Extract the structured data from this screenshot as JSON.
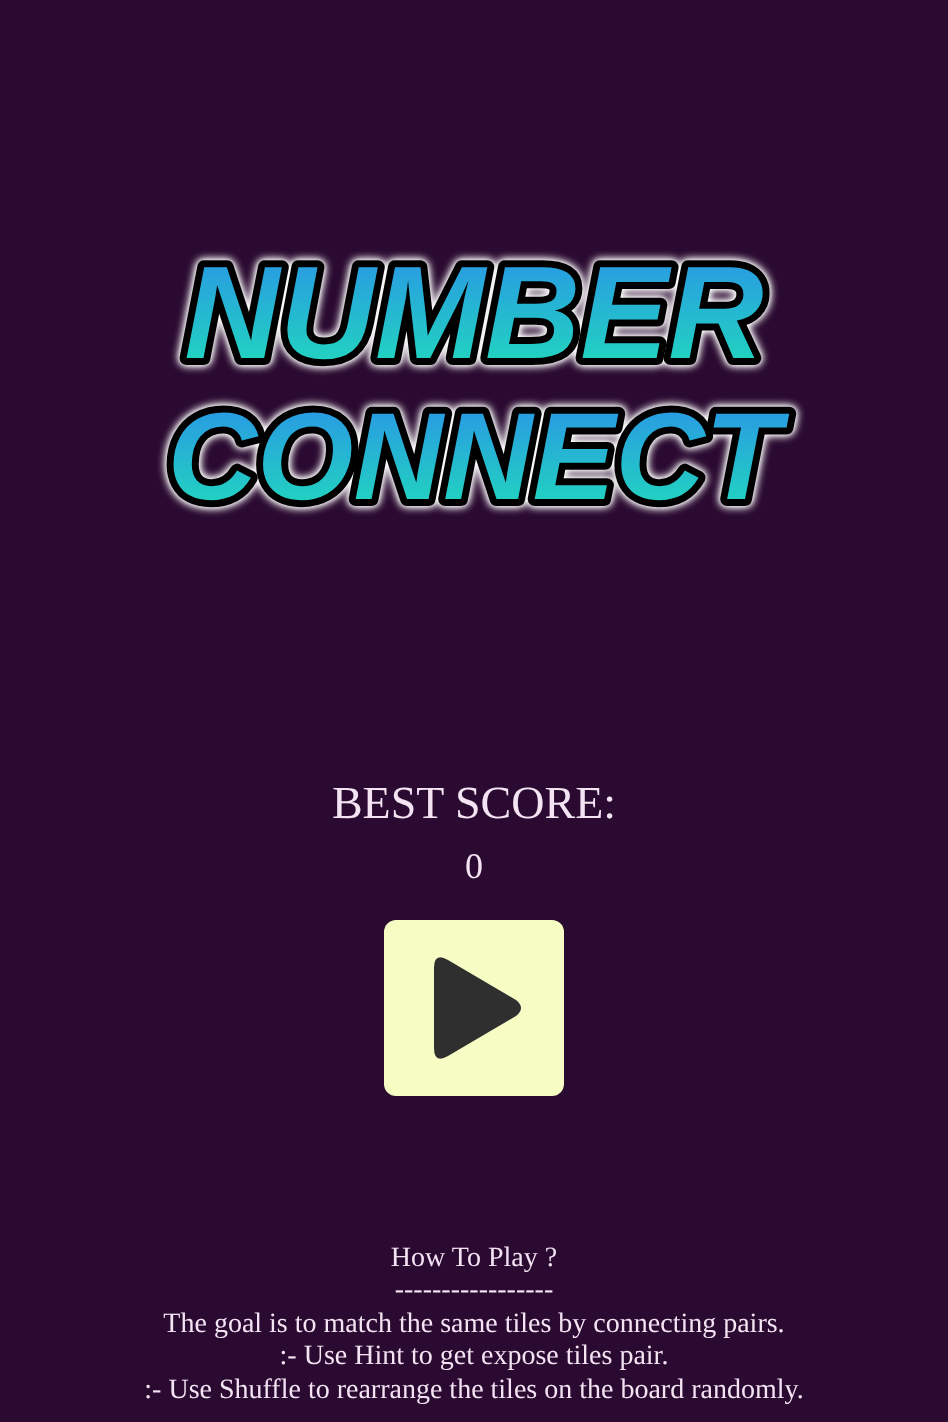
{
  "title": {
    "lines": [
      "NUMBER",
      "CONNECT"
    ]
  },
  "best_score": {
    "label": "BEST SCORE:",
    "value": "0"
  },
  "play_button": {
    "kind": "play"
  },
  "how_to_play": {
    "heading": "How To Play ?",
    "divider": "-----------------",
    "lines": [
      "The goal is to match the same tiles by connecting pairs.",
      ":- Use Hint to get expose tiles pair.",
      ":- Use Shuffle to rearrange the tiles on the board randomly."
    ]
  }
}
